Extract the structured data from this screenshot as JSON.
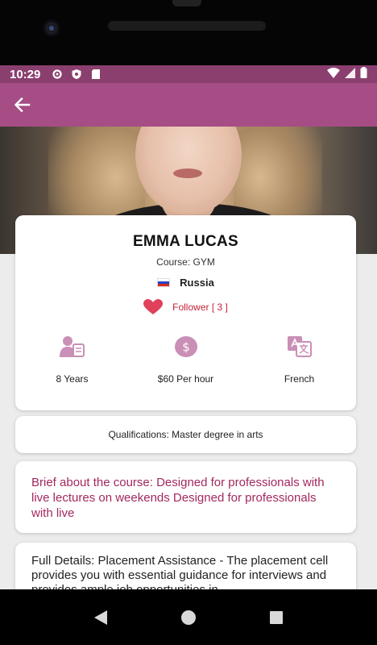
{
  "status_bar": {
    "time": "10:29",
    "left_icons": [
      "gear-icon",
      "shield-icon",
      "sd-card-icon"
    ],
    "right_icons": [
      "wifi-icon",
      "signal-icon",
      "battery-icon"
    ],
    "color": "#8a3f6f"
  },
  "app_bar": {
    "back_icon": "arrow-back-icon",
    "color": "#a64d86"
  },
  "profile": {
    "name": "EMMA LUCAS",
    "course": "Course: GYM",
    "country": "Russia",
    "follower_text": "Follower [ 3 ]",
    "stats": [
      {
        "icon": "person-badge-icon",
        "label": "8 Years"
      },
      {
        "icon": "dollar-coin-icon",
        "label": "$60 Per hour"
      },
      {
        "icon": "translate-icon",
        "label": "French"
      }
    ]
  },
  "qualifications": {
    "text": "Qualifications:  Master degree in arts"
  },
  "brief": {
    "text": "Brief about the course: Designed for professionals with live lectures on weekends Designed for professionals with live"
  },
  "full_details": {
    "text": "Full Details: Placement Assistance - The placement cell provides you with essential guidance for interviews and provides ample job opportunities in"
  },
  "colors": {
    "accent": "#a64d86",
    "brief_text": "#a3285f",
    "heart": "#e0415a",
    "icon_tint": "#c98fb6"
  },
  "nav_bar": {
    "buttons": [
      "back-triangle-icon",
      "home-circle-icon",
      "recents-square-icon"
    ]
  }
}
